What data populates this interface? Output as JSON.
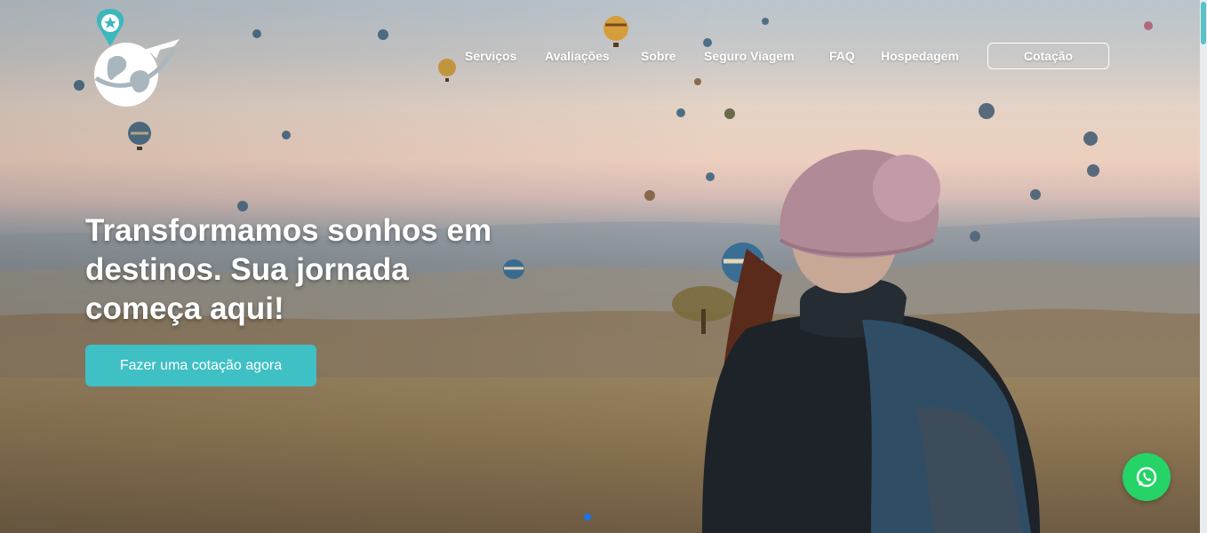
{
  "nav": {
    "items": [
      {
        "label": "Serviços"
      },
      {
        "label": "Avaliações"
      },
      {
        "label": "Sobre"
      },
      {
        "label": "Seguro Viagem"
      },
      {
        "label": "FAQ"
      },
      {
        "label": "Hospedagem"
      }
    ],
    "cta_label": "Cotação"
  },
  "hero": {
    "headline": "Transformamos sonhos em destinos. Sua jornada começa aqui!",
    "button_label": "Fazer uma cotação agora"
  },
  "colors": {
    "accent": "#3fc0c4",
    "whatsapp": "#25d366",
    "carousel_dot": "#1a73e8"
  },
  "icons": {
    "logo": "globe-airplane-pin-logo",
    "floating": "whatsapp-icon"
  }
}
